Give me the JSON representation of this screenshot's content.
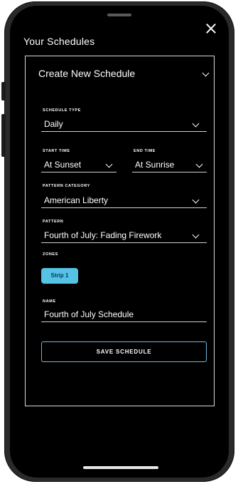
{
  "header": {
    "title": "Your Schedules"
  },
  "panel": {
    "heading": "Create New Schedule"
  },
  "form": {
    "schedule_type": {
      "label": "SCHEDULE TYPE",
      "value": "Daily"
    },
    "start_time": {
      "label": "START TIME",
      "value": "At Sunset"
    },
    "end_time": {
      "label": "END TIME",
      "value": "At Sunrise"
    },
    "pattern_category": {
      "label": "PATTERN CATEGORY",
      "value": "American Liberty"
    },
    "pattern": {
      "label": "PATTERN",
      "value": "Fourth of July: Fading Firework"
    },
    "zones": {
      "label": "ZONES",
      "chip": "Strip 1"
    },
    "name": {
      "label": "NAME",
      "value": "Fourth of July Schedule"
    },
    "save_label": "SAVE SCHEDULE"
  },
  "colors": {
    "accent": "#56c2e6",
    "button_border": "#6fb9de",
    "background": "#000000"
  }
}
